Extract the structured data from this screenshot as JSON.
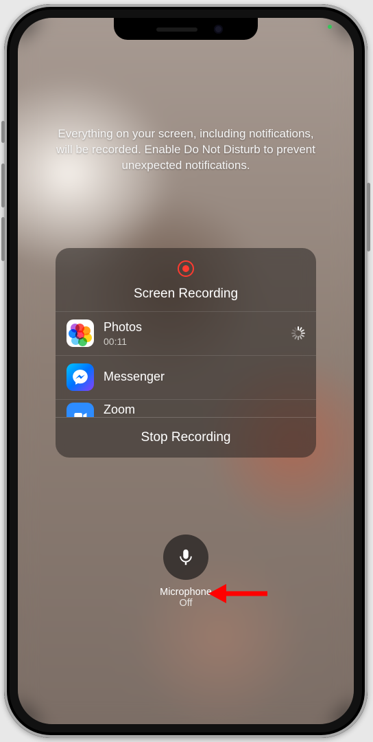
{
  "notice_text": "Everything on your screen, including notifications, will be recorded. Enable Do Not Disturb to prevent unexpected notifications.",
  "panel": {
    "title": "Screen Recording",
    "stop_label": "Stop Recording",
    "apps": [
      {
        "name": "Photos",
        "subtitle": "00:11",
        "icon": "photos-icon",
        "loading": true
      },
      {
        "name": "Messenger",
        "subtitle": "",
        "icon": "messenger-icon",
        "loading": false
      },
      {
        "name": "Zoom",
        "subtitle": "",
        "icon": "zoom-icon",
        "loading": false
      }
    ]
  },
  "microphone": {
    "label": "Microphone",
    "state": "Off"
  },
  "colors": {
    "recording_red": "#ff3b30",
    "privacy_green": "#34c759"
  }
}
